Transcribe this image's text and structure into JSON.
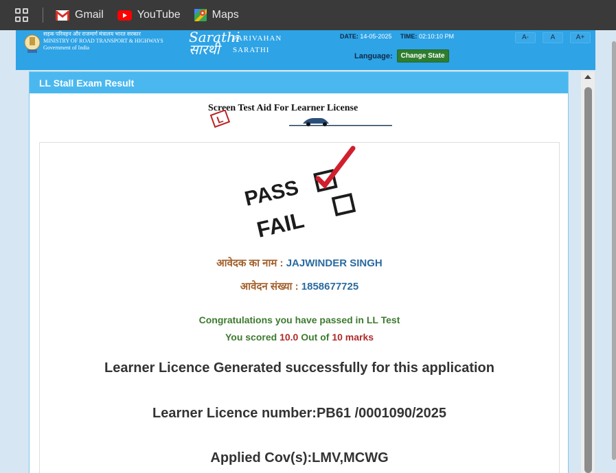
{
  "bookmarks": {
    "items": [
      {
        "label": "Gmail",
        "icon": "gmail-icon"
      },
      {
        "label": "YouTube",
        "icon": "youtube-icon"
      },
      {
        "label": "Maps",
        "icon": "maps-icon"
      }
    ]
  },
  "header": {
    "ministry_hindi": "सड़क परिवहन और राजमार्ग मंत्रालय भारत सरकार",
    "ministry_line1": "MINISTRY OF ROAD TRANSPORT & HIGHWAYS",
    "ministry_line2": "Government of India",
    "sarathi_logo_en": "Sarathi",
    "sarathi_logo_hi": "सारथी",
    "parivahan": "PARIVAHAN",
    "sarathi": "SARATHI",
    "date_label": "DATE:",
    "date_value": "14-05-2025",
    "time_label": "TIME:",
    "time_value": "02:10:10 PM",
    "language_label": "Language:",
    "change_state": "Change State",
    "font_small": "A-",
    "font_normal": "A",
    "font_large": "A+"
  },
  "panel": {
    "title": "LL Stall Exam Result",
    "aid_title": "Screen Test Aid For Learner License"
  },
  "result": {
    "pass_label": "PASS",
    "fail_label": "FAIL",
    "applicant_label": "आवेदक का नाम :",
    "applicant_name": "JAJWINDER SINGH",
    "application_label": "आवेदन संख्या :",
    "application_no": "1858677725",
    "congrats": "Congratulations you have passed in LL Test",
    "score_prefix": "You scored",
    "score_value": "10.0",
    "score_mid": "Out of",
    "score_total": "10 marks",
    "generated": "Learner Licence Generated successfully for this application",
    "licence_number": "Learner Licence number:PB61 /0001090/2025",
    "cov": "Applied Cov(s):LMV,MCWG"
  },
  "colors": {
    "bookmark_bar": "#3a3a3a",
    "header_blue": "#2ea3e6",
    "panel_head": "#4ab8ef",
    "pass_check": "#d0202e",
    "congrats_green": "#3d7a2e",
    "score_red": "#b02a2a"
  }
}
